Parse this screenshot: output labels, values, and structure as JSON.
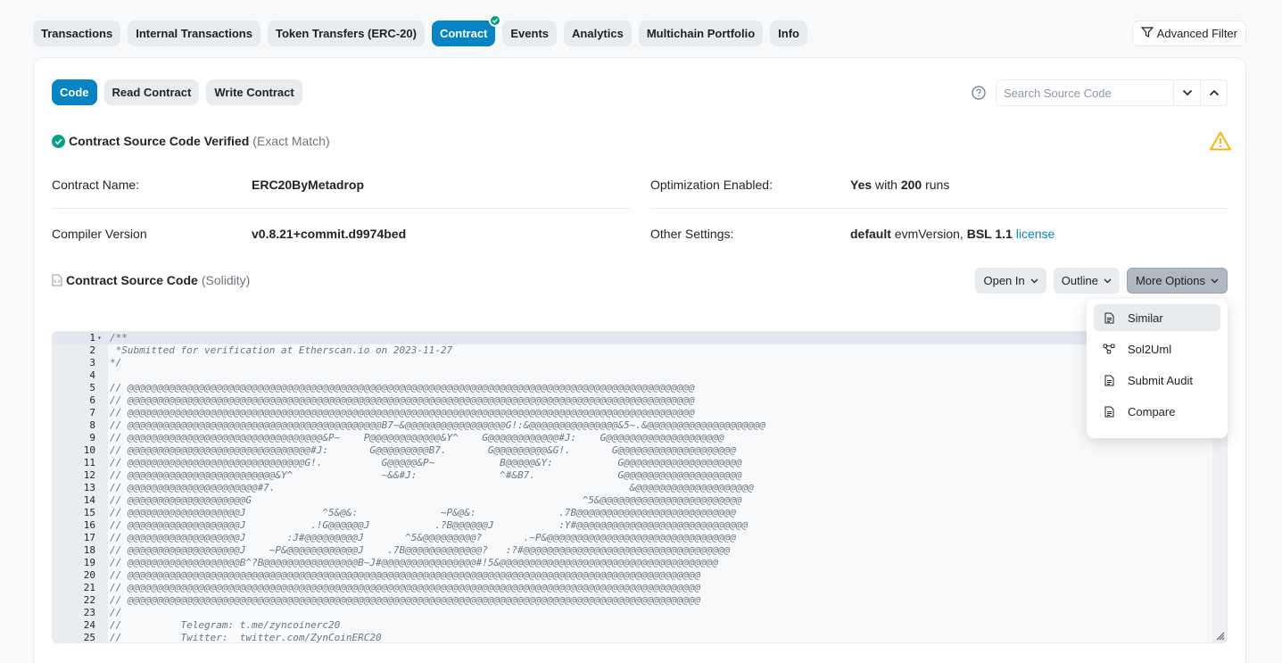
{
  "tabs": [
    {
      "label": "Transactions",
      "active": false
    },
    {
      "label": "Internal Transactions",
      "active": false
    },
    {
      "label": "Token Transfers (ERC-20)",
      "active": false
    },
    {
      "label": "Contract",
      "active": true
    },
    {
      "label": "Events",
      "active": false
    },
    {
      "label": "Analytics",
      "active": false
    },
    {
      "label": "Multichain Portfolio",
      "active": false
    },
    {
      "label": "Info",
      "active": false
    }
  ],
  "advanced_filter": "Advanced Filter",
  "subtabs": [
    {
      "label": "Code",
      "active": true
    },
    {
      "label": "Read Contract",
      "active": false
    },
    {
      "label": "Write Contract",
      "active": false
    }
  ],
  "search": {
    "placeholder": "Search Source Code"
  },
  "verified": {
    "title": "Contract Source Code Verified",
    "match": "(Exact Match)"
  },
  "details": {
    "contract_name_label": "Contract Name:",
    "contract_name": "ERC20ByMetadrop",
    "compiler_label": "Compiler Version",
    "compiler": "v0.8.21+commit.d9974bed",
    "optimization_label": "Optimization Enabled:",
    "optimization_yes": "Yes",
    "optimization_with": "with",
    "optimization_runs": "200",
    "optimization_runs_label": "runs",
    "other_label": "Other Settings:",
    "other_default": "default",
    "other_evm": "evmVersion,",
    "other_license": "BSL 1.1",
    "other_license_link": "license"
  },
  "source": {
    "title": "Contract Source Code",
    "lang": "(Solidity)"
  },
  "options": {
    "open_in": "Open In",
    "outline": "Outline",
    "more": "More Options"
  },
  "dropdown": [
    {
      "label": "Similar",
      "icon": "file-icon"
    },
    {
      "label": "Sol2Uml",
      "icon": "diagram-icon"
    },
    {
      "label": "Submit Audit",
      "icon": "file-icon"
    },
    {
      "label": "Compare",
      "icon": "file-icon"
    }
  ],
  "code_lines": [
    "/**",
    " *Submitted for verification at Etherscan.io on 2023-11-27",
    "*/",
    "",
    "// @@@@@@@@@@@@@@@@@@@@@@@@@@@@@@@@@@@@@@@@@@@@@@@@@@@@@@@@@@@@@@@@@@@@@@@@@@@@@@@@@@@@@@@@@@@@@@@@",
    "// @@@@@@@@@@@@@@@@@@@@@@@@@@@@@@@@@@@@@@@@@@@@@@@@@@@@@@@@@@@@@@@@@@@@@@@@@@@@@@@@@@@@@@@@@@@@@@@@",
    "// @@@@@@@@@@@@@@@@@@@@@@@@@@@@@@@@@@@@@@@@@@@@@@@@@@@@@@@@@@@@@@@@@@@@@@@@@@@@@@@@@@@@@@@@@@@@@@@@",
    "// @@@@@@@@@@@@@@@@@@@@@@@@@@@@@@@@@@@@@@@@@@@B7~&@@@@@@@@@@@@@@@@@G!:&@@@@@@@@@@@@@@@&5~.&@@@@@@@@@@@@@@@@@@@@",
    "// @@@@@@@@@@@@@@@@@@@@@@@@@@@@@@@@@&P~    P@@@@@@@@@@@@&Y^    G@@@@@@@@@@@@#J:    G@@@@@@@@@@@@@@@@@@@@",
    "// @@@@@@@@@@@@@@@@@@@@@@@@@@@@@@@#J:       G@@@@@@@@@B7.       G@@@@@@@@@&G!.       G@@@@@@@@@@@@@@@@@@@@",
    "// @@@@@@@@@@@@@@@@@@@@@@@@@@@@@@G!.          G@@@@@&P~           B@@@@@&Y:           G@@@@@@@@@@@@@@@@@@@@",
    "// @@@@@@@@@@@@@@@@@@@@@@@@@&Y^               ~&&#J:              ^#&B7.              G@@@@@@@@@@@@@@@@@@@@",
    "// @@@@@@@@@@@@@@@@@@@@@@#7.                                                            &@@@@@@@@@@@@@@@@@@@@",
    "// @@@@@@@@@@@@@@@@@@@@G                                                        ^5&@@@@@@@@@@@@@@@@@@@@@@@@",
    "// @@@@@@@@@@@@@@@@@@@J             ^5&@&:              ~P&@&:              .7B@@@@@@@@@@@@@@@@@@@@@@@@@@@",
    "// @@@@@@@@@@@@@@@@@@@J           .!G@@@@@@J           .?B@@@@@@J           :Y#@@@@@@@@@@@@@@@@@@@@@@@@@@@@@",
    "// @@@@@@@@@@@@@@@@@@@J       :J#@@@@@@@@@J       ^5&@@@@@@@@@?       .~P&@@@@@@@@@@@@@@@@@@@@@@@@@@@@@@@@",
    "// @@@@@@@@@@@@@@@@@@@J    ~P&@@@@@@@@@@@@J    .7B@@@@@@@@@@@@@?   :?#@@@@@@@@@@@@@@@@@@@@@@@@@@@@@@@@@@@",
    "// @@@@@@@@@@@@@@@@@@@B^?B@@@@@@@@@@@@@@@@B~J#@@@@@@@@@@@@@@@@#!5&@@@@@@@@@@@@@@@@@@@@@@@@@@@@@@@@@@@@@",
    "// @@@@@@@@@@@@@@@@@@@@@@@@@@@@@@@@@@@@@@@@@@@@@@@@@@@@@@@@@@@@@@@@@@@@@@@@@@@@@@@@@@@@@@@@@@@@@@@@@",
    "// @@@@@@@@@@@@@@@@@@@@@@@@@@@@@@@@@@@@@@@@@@@@@@@@@@@@@@@@@@@@@@@@@@@@@@@@@@@@@@@@@@@@@@@@@@@@@@@@@",
    "// @@@@@@@@@@@@@@@@@@@@@@@@@@@@@@@@@@@@@@@@@@@@@@@@@@@@@@@@@@@@@@@@@@@@@@@@@@@@@@@@@@@@@@@@@@@@@@@@@",
    "//",
    "//          Telegram: t.me/zyncoinerc20",
    "//          Twitter:  twitter.com/ZynCoinERC20"
  ]
}
